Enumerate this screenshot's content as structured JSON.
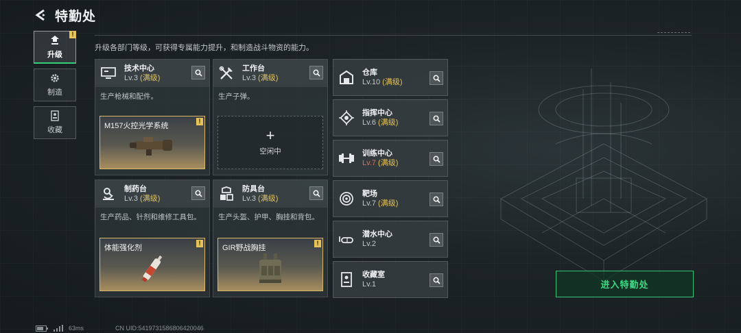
{
  "header": {
    "title": "特勤处"
  },
  "nav": [
    {
      "label": "升级",
      "icon": "upgrade-icon",
      "active": true,
      "badge": "!"
    },
    {
      "label": "制造",
      "icon": "gear-icon",
      "active": false
    },
    {
      "label": "收藏",
      "icon": "collection-icon",
      "active": false
    }
  ],
  "description": "升级各部门等级，可获得专属能力提升，和制造战斗物资的能力。",
  "workshops": [
    {
      "name": "技术中心",
      "level": "Lv.3",
      "max": "(满级)",
      "desc": "生产枪械和配件。",
      "icon": "monitor-icon",
      "slot": {
        "item": "M157火控光学系统",
        "badge": "!",
        "art": "scope-item"
      }
    },
    {
      "name": "工作台",
      "level": "Lv.3",
      "max": "(满级)",
      "desc": "生产子弹。",
      "icon": "tools-icon",
      "slot": {
        "idle_plus": "+",
        "idle_label": "空闲中"
      }
    },
    {
      "name": "制药台",
      "level": "Lv.3",
      "max": "(满级)",
      "desc": "生产药品、针剂和维修工具包。",
      "icon": "microscope-icon",
      "slot": {
        "item": "体能强化剂",
        "badge": "!",
        "art": "syringe-item"
      }
    },
    {
      "name": "防具台",
      "level": "Lv.3",
      "max": "(满级)",
      "desc": "生产头盔、护甲、胸挂和背包。",
      "icon": "armor-icon",
      "slot": {
        "item": "GIR野战胸挂",
        "badge": "!",
        "art": "vest-item"
      }
    }
  ],
  "facilities": [
    {
      "name": "仓库",
      "level": "Lv.10",
      "max": "(满级)",
      "icon": "warehouse-icon"
    },
    {
      "name": "指挥中心",
      "level": "Lv.6",
      "max": "(满级)",
      "icon": "chip-icon"
    },
    {
      "name": "训练中心",
      "level": "Lv.7",
      "max": "(满级)",
      "icon": "dumbbell-icon",
      "red_level": true
    },
    {
      "name": "靶场",
      "level": "Lv.7",
      "max": "(满级)",
      "icon": "target-icon"
    },
    {
      "name": "潜水中心",
      "level": "Lv.2",
      "max": "",
      "icon": "diving-mask-icon"
    },
    {
      "name": "收藏室",
      "level": "Lv.1",
      "max": "",
      "icon": "display-case-icon"
    }
  ],
  "enter_button": "进入特勤处",
  "footer": {
    "ping": "63ms",
    "uid": "CN UID:5419731586806420046"
  },
  "colors": {
    "accent_green": "#36d07a",
    "max_level": "#e3c25a",
    "badge": "#e6c25a",
    "warning_level": "#d57068"
  }
}
